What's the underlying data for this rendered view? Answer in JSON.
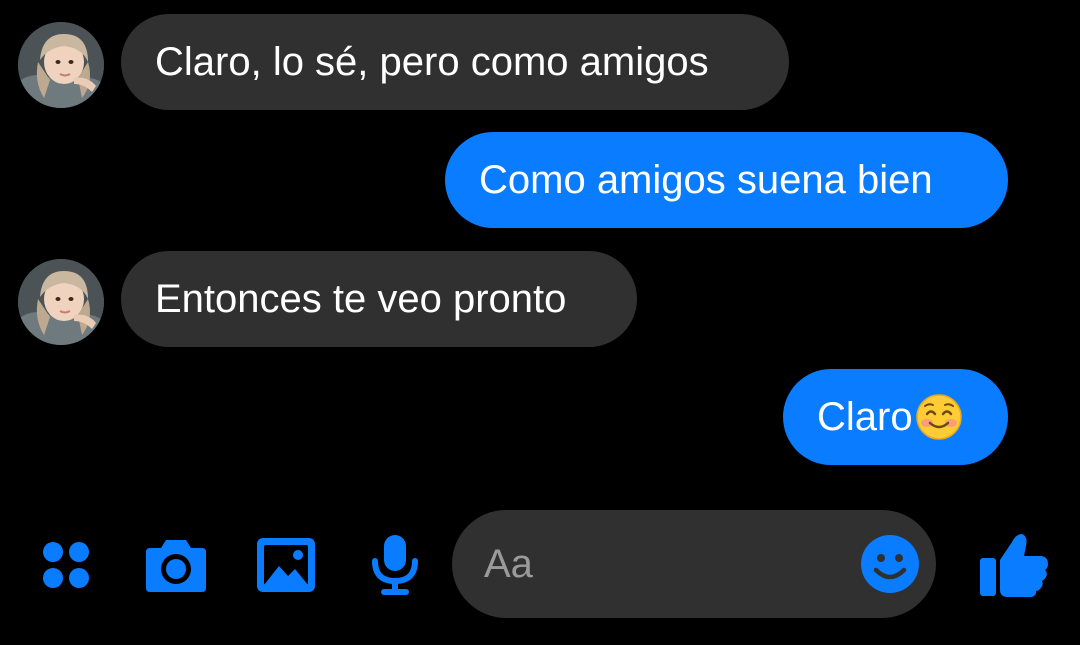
{
  "thread": {
    "messages": [
      {
        "direction": "in",
        "text": "Claro, lo sé, pero como amigos"
      },
      {
        "direction": "out",
        "text": "Como amigos suena bien"
      },
      {
        "direction": "in",
        "text": "Entonces te veo pronto"
      },
      {
        "direction": "out",
        "text": "Claro",
        "emoji": "smiling-face-with-rosy-cheeks"
      }
    ]
  },
  "composer": {
    "placeholder": "Aa"
  },
  "toolbar": {
    "icons": [
      "menu-grid-icon",
      "camera-icon",
      "image-icon",
      "microphone-icon",
      "emoji-icon",
      "thumbs-up-icon"
    ]
  },
  "colors": {
    "background": "#000000",
    "incoming_bubble": "#303030",
    "outgoing_bubble": "#0a7cff",
    "accent": "#0a7cff",
    "text": "#ffffff",
    "placeholder": "#9a9a9a"
  }
}
